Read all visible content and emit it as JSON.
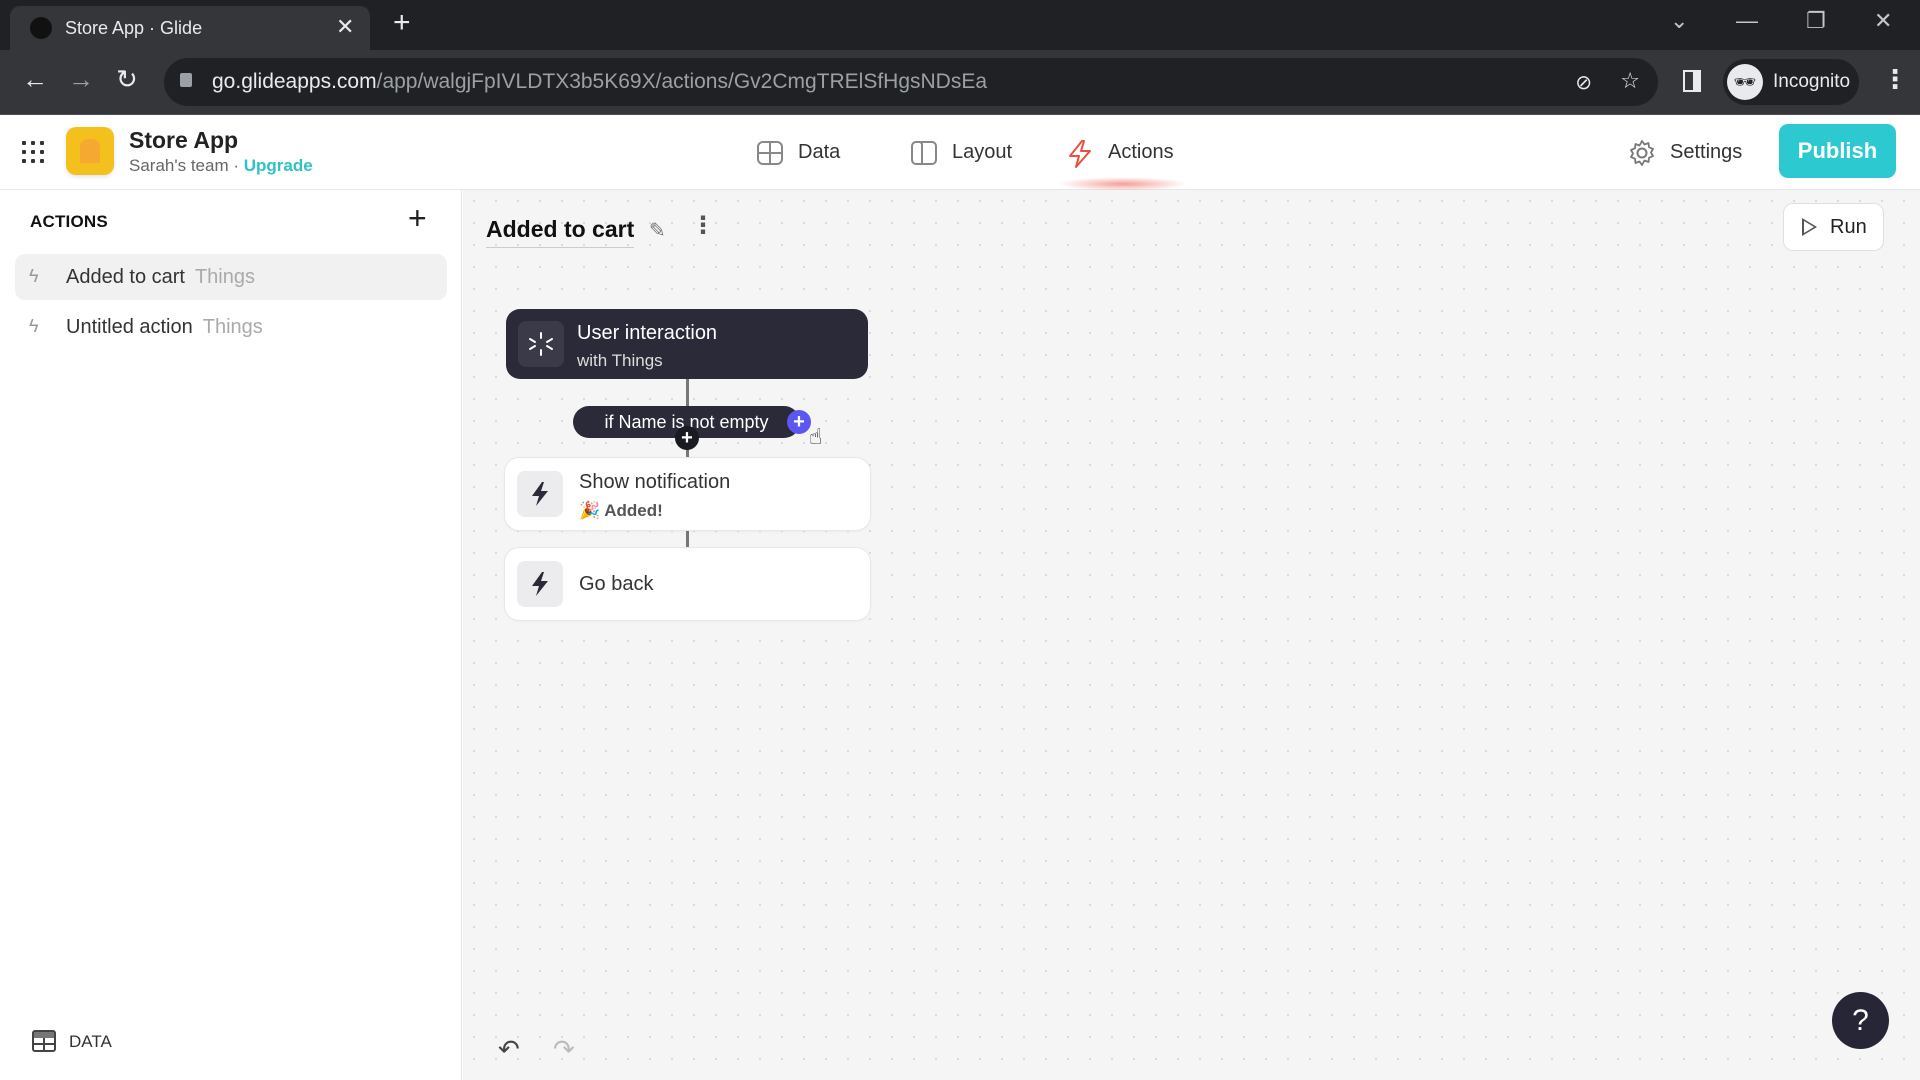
{
  "browser": {
    "tab_title": "Store App · Glide",
    "url_host": "go.glideapps.com",
    "url_path": "/app/walgjFpIVLDTX3b5K69X/actions/Gv2CmgTRElSfHgsNDsEa",
    "profile_label": "Incognito",
    "icons": {
      "back": "←",
      "forward": "→",
      "reload": "↻",
      "close_tab": "✕",
      "new_tab": "+",
      "star": "☆",
      "eye_off": "⊘",
      "menu": "⋮",
      "minimize": "—",
      "restore": "❐",
      "close": "✕",
      "tab_list": "⌄"
    }
  },
  "app": {
    "name": "Store App",
    "team": "Sarah's team",
    "separator": " · ",
    "upgrade_label": "Upgrade",
    "nav": [
      {
        "label": "Data",
        "icon": "table-icon"
      },
      {
        "label": "Layout",
        "icon": "layout-icon"
      },
      {
        "label": "Actions",
        "icon": "lightning-icon",
        "active": true
      }
    ],
    "settings_label": "Settings",
    "publish_label": "Publish",
    "colors": {
      "accent": "#2ccad0",
      "actions_active": "#e9503f",
      "cta_add": "#5b57f1"
    }
  },
  "sidebar": {
    "title": "ACTIONS",
    "add_icon": "+",
    "items": [
      {
        "name": "Added to cart",
        "table": "Things",
        "active": true
      },
      {
        "name": "Untitled action",
        "table": "Things",
        "active": false
      }
    ],
    "footer_label": "DATA"
  },
  "canvas": {
    "flow_title": "Added to cart",
    "run_label": "Run",
    "trigger": {
      "title": "User interaction",
      "subtitle": "with Things"
    },
    "condition": {
      "label": "if Name is not empty"
    },
    "steps": [
      {
        "title": "Show notification",
        "subtitle_emoji": "🎉",
        "subtitle": "Added!"
      },
      {
        "title": "Go back"
      }
    ],
    "undo_icon": "↶",
    "redo_icon": "↷",
    "help_label": "?"
  }
}
